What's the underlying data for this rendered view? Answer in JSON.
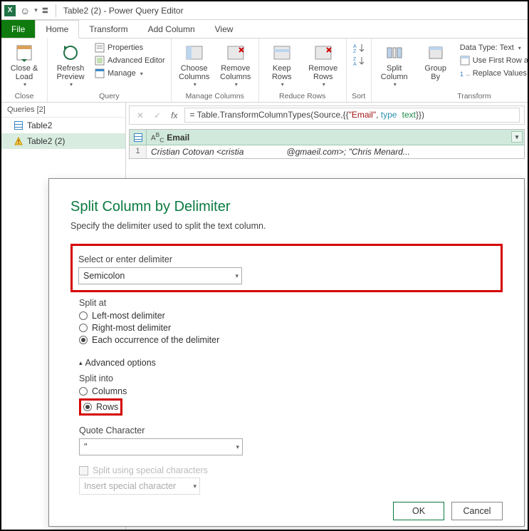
{
  "window": {
    "title": "Table2 (2) - Power Query Editor"
  },
  "tabs": {
    "file": "File",
    "home": "Home",
    "transform": "Transform",
    "add_column": "Add Column",
    "view": "View"
  },
  "ribbon": {
    "close": {
      "button": "Close &\nLoad",
      "group": "Close"
    },
    "query": {
      "refresh": "Refresh\nPreview",
      "properties": "Properties",
      "advanced": "Advanced Editor",
      "manage": "Manage",
      "group": "Query"
    },
    "manage_cols": {
      "choose": "Choose\nColumns",
      "remove": "Remove\nColumns",
      "group": "Manage Columns"
    },
    "reduce_rows": {
      "keep": "Keep\nRows",
      "remove": "Remove\nRows",
      "group": "Reduce Rows"
    },
    "sort": {
      "group": "Sort"
    },
    "transform": {
      "split": "Split\nColumn",
      "group_by": "Group\nBy",
      "datatype": "Data Type: Text",
      "firstrow": "Use First Row as Headers",
      "replace": "Replace Values",
      "group": "Transform"
    }
  },
  "queries": {
    "header": "Queries [2]",
    "items": [
      "Table2",
      "Table2 (2)"
    ]
  },
  "formula": {
    "prefix": "= Table.TransformColumnTypes(Source,{{",
    "email": "\"Email\"",
    "sep": ", ",
    "type": "type",
    "text": "text",
    "suffix": "}})"
  },
  "grid": {
    "column": "Email",
    "row1_a": "Cristian Cotovan <cristia",
    "row1_b": "@gmaeil.com>; \"Chris Menard..."
  },
  "dialog": {
    "title": "Split Column by Delimiter",
    "subtitle": "Specify the delimiter used to split the text column.",
    "delimiter_label": "Select or enter delimiter",
    "delimiter_value": "Semicolon",
    "split_at_label": "Split at",
    "split_at": {
      "left": "Left-most delimiter",
      "right": "Right-most delimiter",
      "each": "Each occurrence of the delimiter"
    },
    "advanced": "Advanced options",
    "split_into_label": "Split into",
    "split_into": {
      "columns": "Columns",
      "rows": "Rows"
    },
    "quote_label": "Quote Character",
    "quote_value": "\"",
    "special_check": "Split using special characters",
    "special_combo": "Insert special character",
    "ok": "OK",
    "cancel": "Cancel"
  }
}
